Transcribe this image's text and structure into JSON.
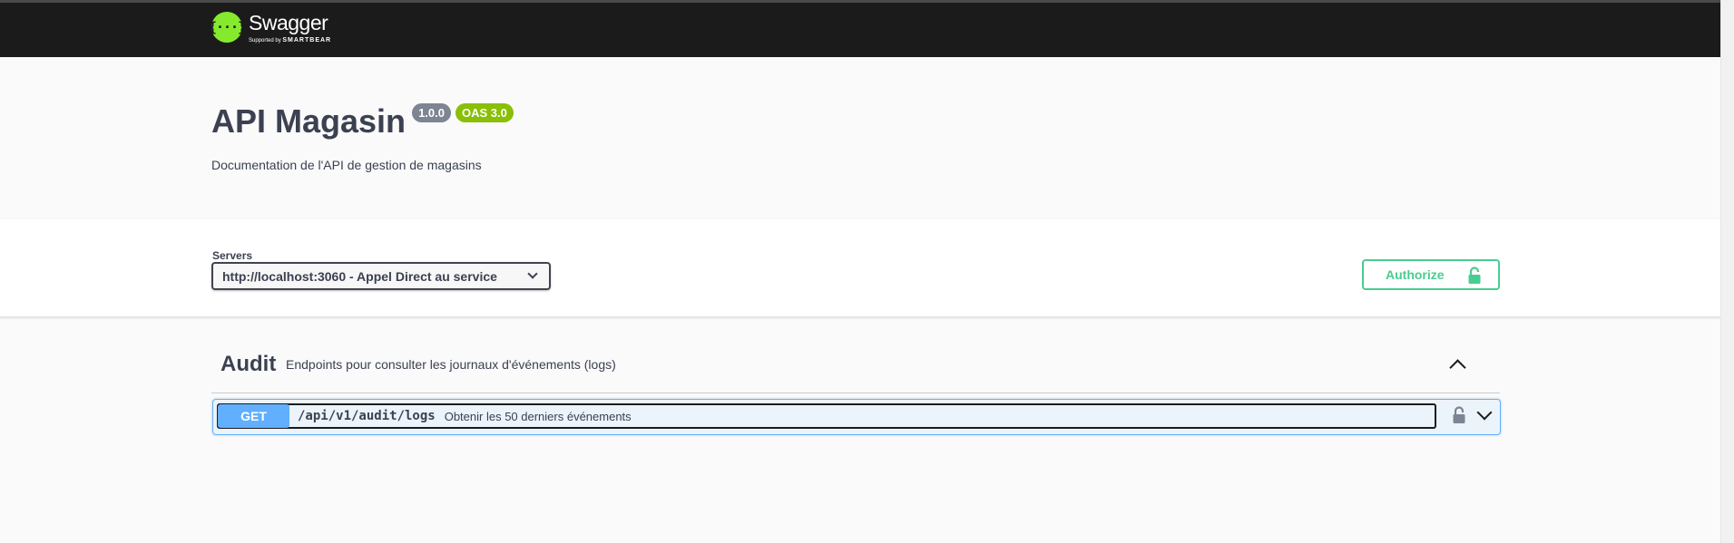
{
  "topbar": {
    "brand_name": "Swagger",
    "brand_mark": "{···}",
    "supported_by": "Supported by",
    "supported_company": "SMARTBEAR"
  },
  "info": {
    "title": "API Magasin",
    "version_badge": "1.0.0",
    "oas_badge": "OAS 3.0",
    "description": "Documentation de l'API de gestion de magasins"
  },
  "servers": {
    "label": "Servers",
    "selected": "http://localhost:3060 - Appel Direct au service"
  },
  "authorize": {
    "label": "Authorize"
  },
  "tags": [
    {
      "name": "Audit",
      "description": "Endpoints pour consulter les journaux d'événements (logs)",
      "operations": [
        {
          "method": "GET",
          "path": "/api/v1/audit/logs",
          "summary": "Obtenir les 50 derniers événements"
        }
      ]
    }
  ],
  "colors": {
    "topbar_bg": "#1b1b1b",
    "brand_green": "#85ea2d",
    "authorize_green": "#49cc90",
    "get_blue": "#61affe",
    "oas_green": "#89bf04",
    "version_gray": "#7d8492"
  },
  "icons": {
    "logo": "swagger-logo-icon",
    "select_chevron": "chevron-down-icon",
    "authorize_lock": "unlock-icon",
    "tag_toggle": "chevron-up-icon",
    "op_lock": "lock-icon",
    "op_toggle": "chevron-down-icon"
  }
}
